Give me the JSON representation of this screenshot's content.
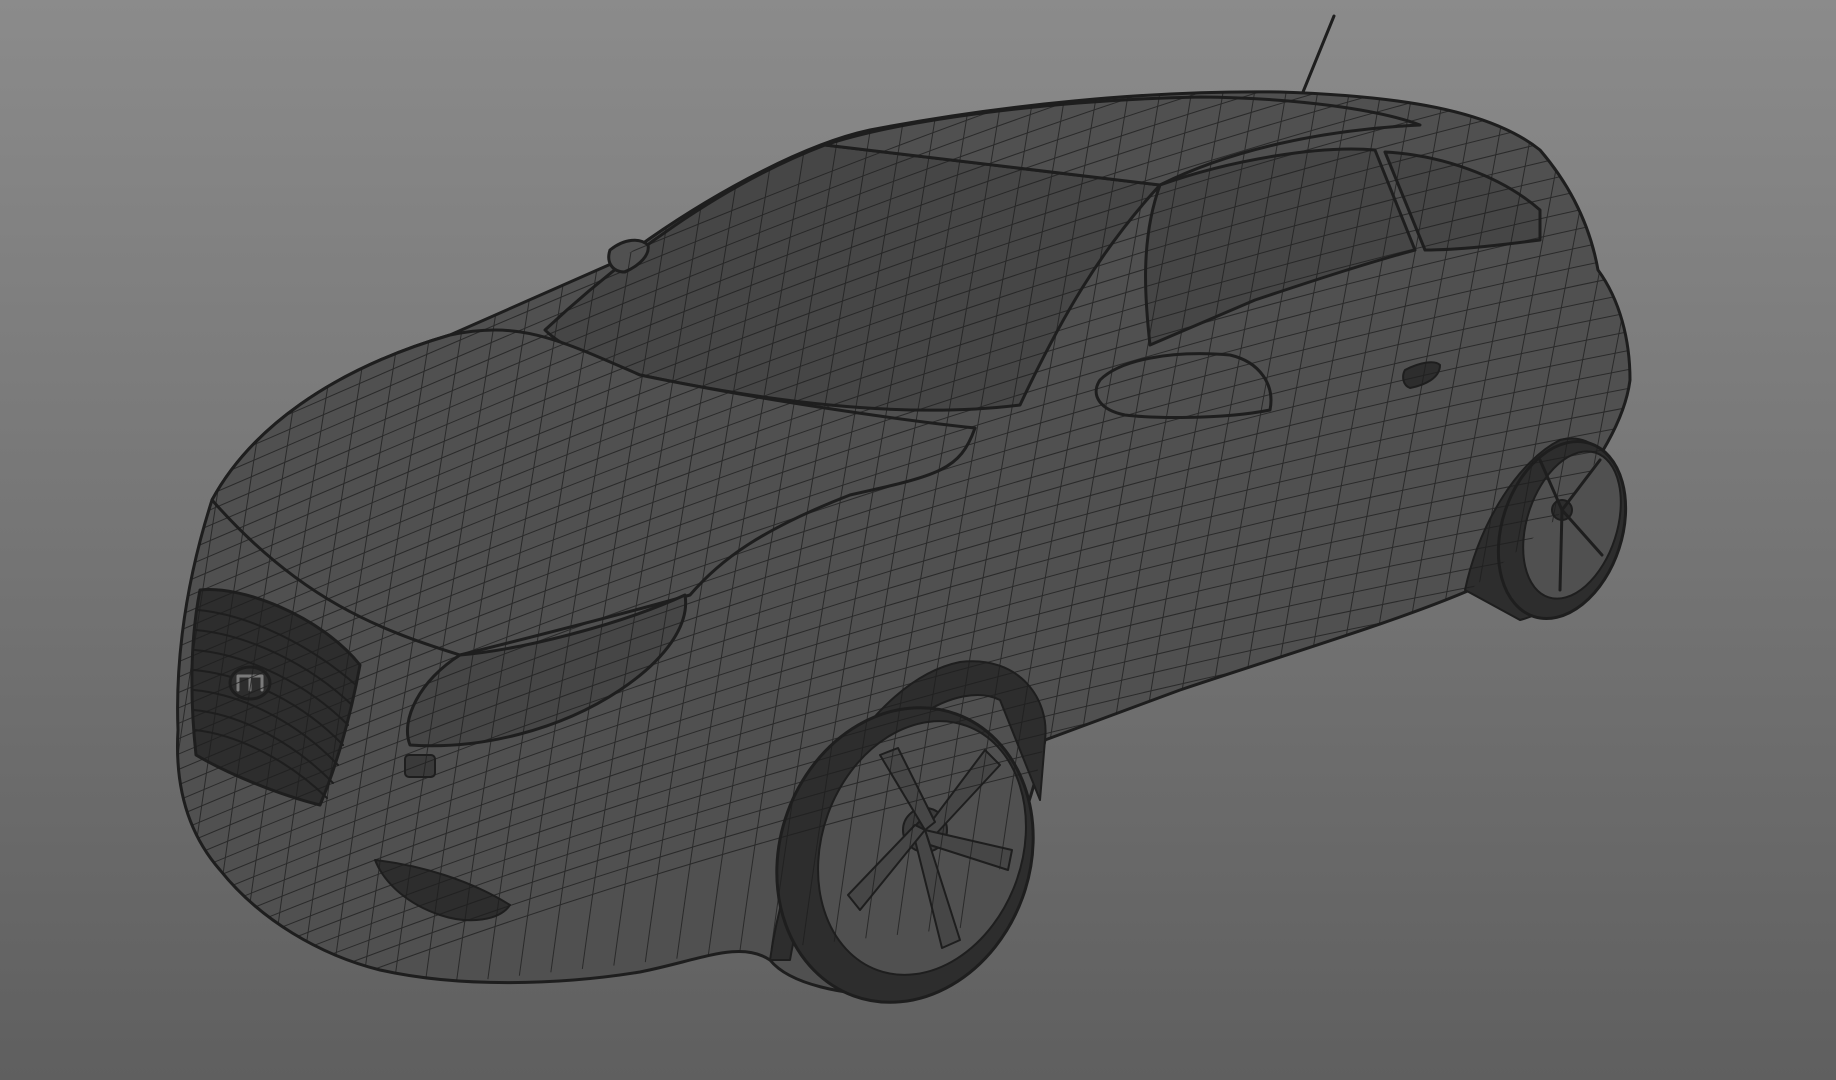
{
  "viewport": {
    "background_top": "#8b8b8b",
    "background_bottom": "#5f5f5f",
    "mesh_line_color": "#1e1e1e",
    "surface_color": "#505050",
    "glass_color": "#464646",
    "rubber_color": "#2d2d2d"
  },
  "model": {
    "icon": "car-wireframe-icon"
  }
}
